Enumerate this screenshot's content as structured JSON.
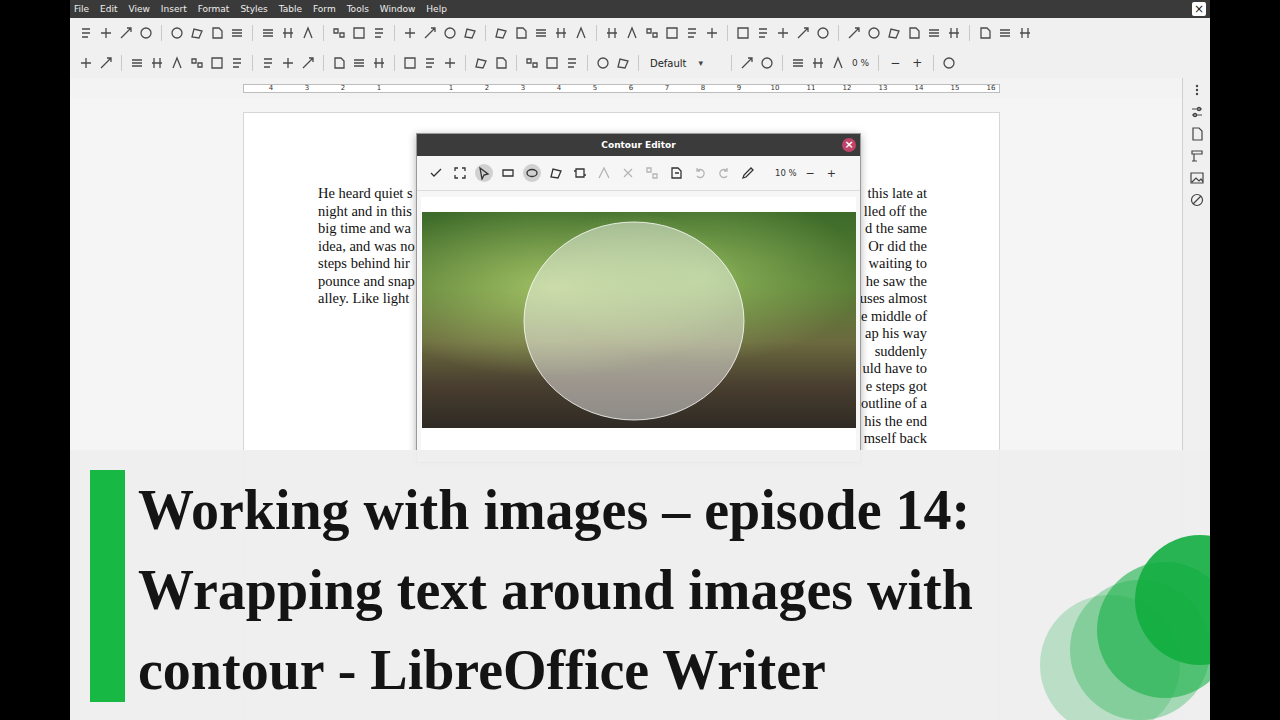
{
  "window": {
    "close": "×"
  },
  "menu": [
    "File",
    "Edit",
    "View",
    "Insert",
    "Format",
    "Styles",
    "Table",
    "Form",
    "Tools",
    "Window",
    "Help"
  ],
  "toolbar": {
    "paragraph_style": "Default",
    "style_arrow": "▾",
    "zoom": "0 %",
    "zoom_minus": "−",
    "zoom_plus": "+"
  },
  "ruler": {
    "left": [
      "4",
      "3",
      "2",
      "1"
    ],
    "right": [
      "1",
      "2",
      "3",
      "4",
      "5",
      "6",
      "7",
      "8",
      "9",
      "10",
      "11",
      "12",
      "13",
      "14",
      "15",
      "16"
    ]
  },
  "document": {
    "lines": [
      {
        "left": "He heard quiet s",
        "right": "this late at"
      },
      {
        "left": "night and in this",
        "right": "lled off the"
      },
      {
        "left": "big time and wa",
        "right": "d the same"
      },
      {
        "left": "idea, and was no",
        "right": "Or did the"
      },
      {
        "left": "steps behind hir",
        "right": "waiting to"
      },
      {
        "left": "pounce and snap",
        "right": "he saw the"
      },
      {
        "left": "alley. Like light",
        "right": "uses almost"
      },
      {
        "left": "",
        "right": "e middle of"
      },
      {
        "left": "",
        "right": "ap his way"
      },
      {
        "left": "",
        "right": "suddenly"
      },
      {
        "left": "",
        "right": "uld have to"
      },
      {
        "left": "",
        "right": "e steps got"
      },
      {
        "left": "",
        "right": "outline of a"
      },
      {
        "left": "",
        "right": "his the end"
      },
      {
        "left": "",
        "right": "mself back"
      }
    ]
  },
  "dialog": {
    "title": "Contour Editor",
    "close": "×",
    "zoom": "10 %",
    "zoom_minus": "−",
    "zoom_plus": "+",
    "tools": [
      {
        "selected": false,
        "disabled": false
      },
      {
        "selected": false,
        "disabled": false
      },
      {
        "selected": true,
        "disabled": false
      },
      {
        "selected": false,
        "disabled": false
      },
      {
        "selected": true,
        "disabled": false
      },
      {
        "selected": false,
        "disabled": false
      },
      {
        "selected": false,
        "disabled": false
      },
      {
        "selected": false,
        "disabled": true
      },
      {
        "selected": false,
        "disabled": true
      },
      {
        "selected": false,
        "disabled": true
      },
      {
        "selected": false,
        "disabled": false
      },
      {
        "selected": false,
        "disabled": true
      },
      {
        "selected": false,
        "disabled": true
      },
      {
        "selected": false,
        "disabled": false
      }
    ]
  },
  "banner": {
    "lines": [
      "Working with images – episode 14:",
      "Wrapping text around images with",
      "contour - LibreOffice Writer"
    ]
  }
}
